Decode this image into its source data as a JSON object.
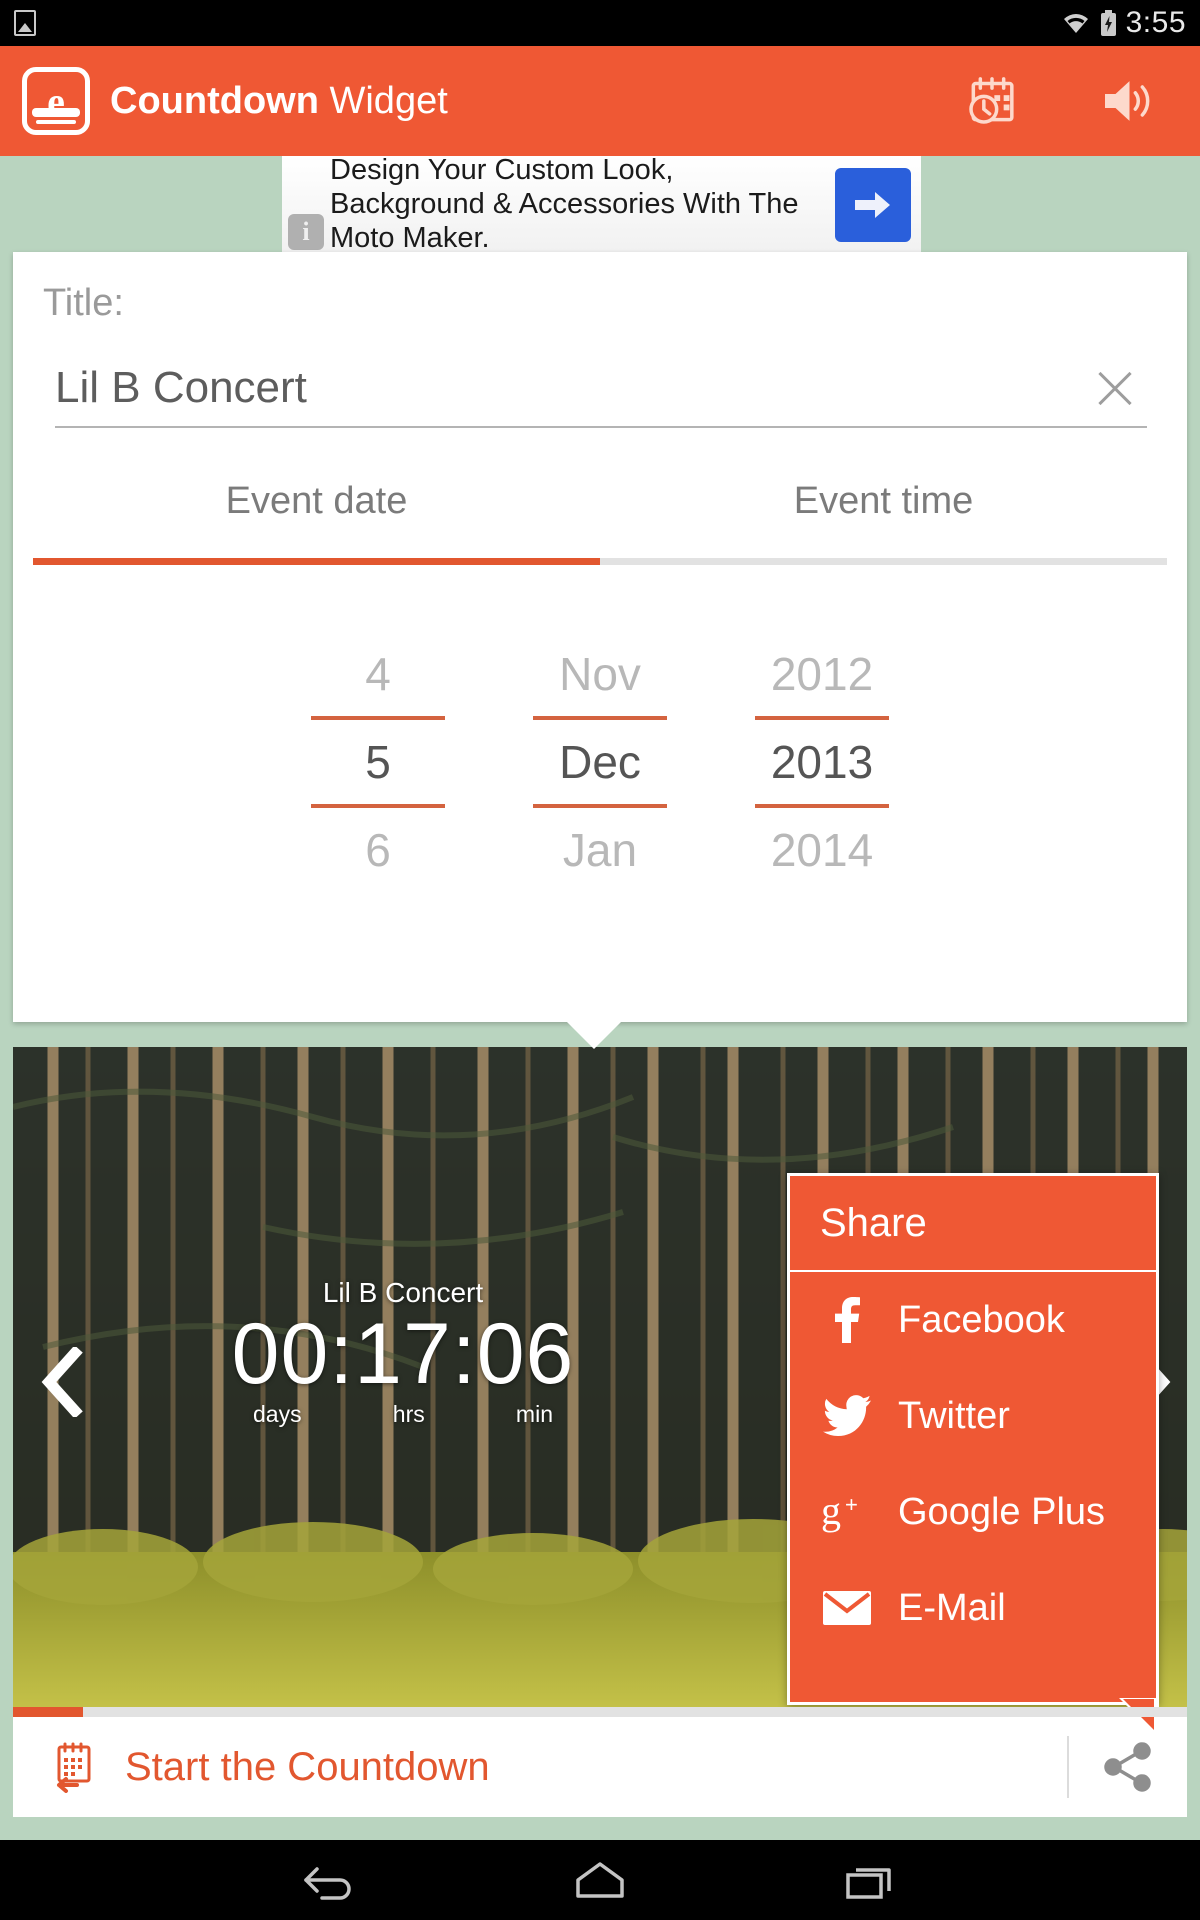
{
  "statusbar": {
    "time": "3:55",
    "photo_icon": "photo-icon",
    "wifi_icon": "wifi-icon",
    "battery_icon": "battery-charging-icon"
  },
  "appbar": {
    "title_bold": "Countdown",
    "title_light": "Widget",
    "logo_letter": "e",
    "logo_name": "countdown-widget-logo",
    "actions": [
      {
        "name": "calendar-clock-icon",
        "label": "Event reminder"
      },
      {
        "name": "speaker-icon",
        "label": "Sound"
      }
    ]
  },
  "ad": {
    "info_badge": "i",
    "text": "Design Your Custom Look, Background & Accessories With The Moto Maker.",
    "cta_icon": "arrow-right-icon",
    "cta_color": "#2a5fdb"
  },
  "form": {
    "title_label": "Title:",
    "title_value": "Lil B Concert",
    "title_placeholder": "Title",
    "clear_icon": "close-icon",
    "tabs": [
      {
        "label": "Event date",
        "selected": true
      },
      {
        "label": "Event time",
        "selected": false
      }
    ],
    "date_picker": {
      "day": {
        "prev": "4",
        "current": "5",
        "next": "6"
      },
      "month": {
        "prev": "Nov",
        "current": "Dec",
        "next": "Jan"
      },
      "year": {
        "prev": "2012",
        "current": "2013",
        "next": "2014"
      }
    }
  },
  "preview": {
    "countdown_title": "Lil B Concert",
    "countdown_time": "00:17:06",
    "units": [
      "days",
      "hrs",
      "min"
    ],
    "prev_icon": "chevron-left-icon",
    "next_icon": "chevron-right-icon"
  },
  "share_popup": {
    "heading": "Share",
    "items": [
      {
        "label": "Facebook",
        "icon": "facebook-icon"
      },
      {
        "label": "Twitter",
        "icon": "twitter-icon"
      },
      {
        "label": "Google Plus",
        "icon": "google-plus-icon"
      },
      {
        "label": "E-Mail",
        "icon": "email-icon"
      }
    ]
  },
  "bottombar": {
    "start_label": "Start the Countdown",
    "start_icon": "calendar-back-icon",
    "share_icon": "share-icon",
    "progress_percent": 6
  },
  "navbar": {
    "back": "back-icon",
    "home": "home-icon",
    "recents": "recents-icon"
  },
  "colors": {
    "accent": "#ef5834",
    "accent_dark": "#e2572f",
    "background": "#b9d4bf",
    "card": "#ffffff"
  }
}
